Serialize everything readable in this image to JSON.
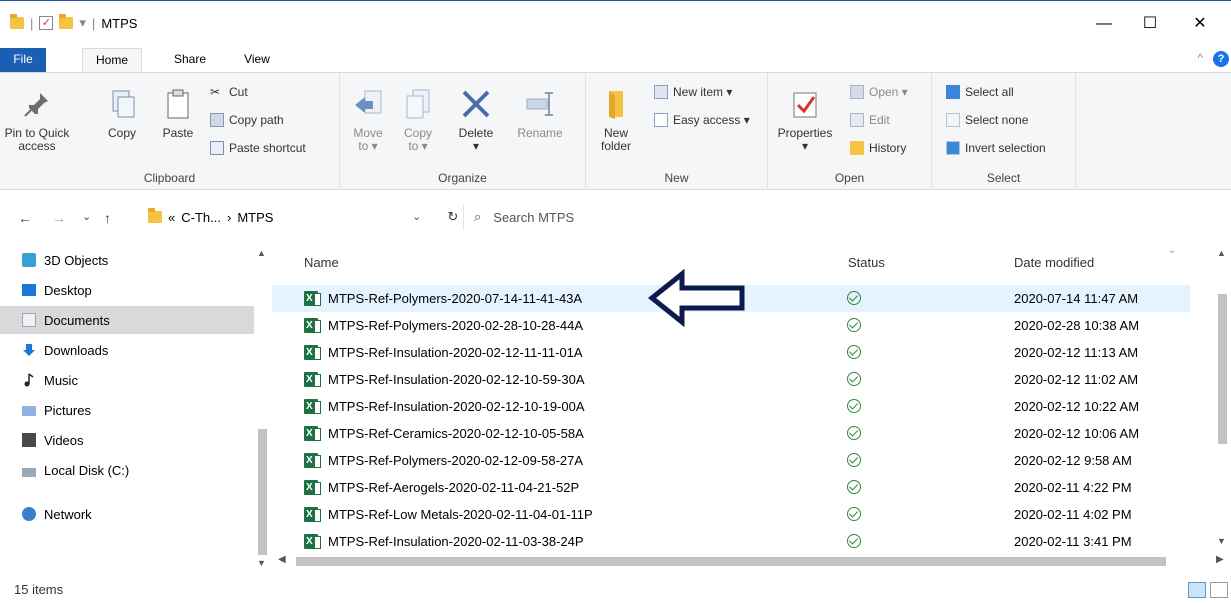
{
  "window": {
    "title": "MTPS",
    "qat_separator": "|",
    "qat_dropdown": "▾",
    "minimize": "—",
    "maximize": "☐",
    "close": "✕"
  },
  "ribbon_tabs": {
    "file": "File",
    "home": "Home",
    "share": "Share",
    "view": "View",
    "collapse": "^",
    "help": "?"
  },
  "clipboard": {
    "pin": "Pin to Quick access",
    "copy": "Copy",
    "paste": "Paste",
    "cut": "Cut",
    "copy_path": "Copy path",
    "paste_shortcut": "Paste shortcut",
    "label": "Clipboard"
  },
  "organize": {
    "move_to": "Move to ▾",
    "copy_to": "Copy to ▾",
    "delete": "Delete",
    "delete_dd": "▾",
    "rename": "Rename",
    "label": "Organize"
  },
  "new_group": {
    "new_folder": "New folder",
    "new_item": "New item ▾",
    "easy_access": "Easy access ▾",
    "label": "New"
  },
  "open_group": {
    "properties": "Properties",
    "properties_dd": "▾",
    "open": "Open ▾",
    "edit": "Edit",
    "history": "History",
    "label": "Open"
  },
  "select_group": {
    "select_all": "Select all",
    "select_none": "Select none",
    "invert_selection": "Invert selection",
    "label": "Select"
  },
  "address": {
    "back": "←",
    "forward": "→",
    "recent": "⌄",
    "up": "↑",
    "path_prefix": "«",
    "crumb1": "C-Th...",
    "sep": "›",
    "crumb2": "MTPS",
    "dropdown": "⌄",
    "refresh": "↻",
    "search_icon": "⌕",
    "search_placeholder": "Search MTPS"
  },
  "nav_pane": {
    "items": [
      {
        "label": "3D Objects",
        "icon": "3d-objects-icon"
      },
      {
        "label": "Desktop",
        "icon": "desktop-icon"
      },
      {
        "label": "Documents",
        "icon": "documents-icon"
      },
      {
        "label": "Downloads",
        "icon": "downloads-icon"
      },
      {
        "label": "Music",
        "icon": "music-icon"
      },
      {
        "label": "Pictures",
        "icon": "pictures-icon"
      },
      {
        "label": "Videos",
        "icon": "videos-icon"
      },
      {
        "label": "Local Disk (C:)",
        "icon": "local-disk-icon"
      },
      {
        "label": "Network",
        "icon": "network-icon"
      }
    ],
    "selected": "Documents"
  },
  "file_list": {
    "columns": {
      "name": "Name",
      "status": "Status",
      "date": "Date modified"
    },
    "sort_indicator": "⌄",
    "rows": [
      {
        "name": "MTPS-Ref-Polymers-2020-07-14-11-41-43A",
        "date": "2020-07-14 11:47 AM"
      },
      {
        "name": "MTPS-Ref-Polymers-2020-02-28-10-28-44A",
        "date": "2020-02-28 10:38 AM"
      },
      {
        "name": "MTPS-Ref-Insulation-2020-02-12-11-11-01A",
        "date": "2020-02-12 11:13 AM"
      },
      {
        "name": "MTPS-Ref-Insulation-2020-02-12-10-59-30A",
        "date": "2020-02-12 11:02 AM"
      },
      {
        "name": "MTPS-Ref-Insulation-2020-02-12-10-19-00A",
        "date": "2020-02-12 10:22 AM"
      },
      {
        "name": "MTPS-Ref-Ceramics-2020-02-12-10-05-58A",
        "date": "2020-02-12 10:06 AM"
      },
      {
        "name": "MTPS-Ref-Polymers-2020-02-12-09-58-27A",
        "date": "2020-02-12 9:58 AM"
      },
      {
        "name": "MTPS-Ref-Aerogels-2020-02-11-04-21-52P",
        "date": "2020-02-11 4:22 PM"
      },
      {
        "name": "MTPS-Ref-Low Metals-2020-02-11-04-01-11P",
        "date": "2020-02-11 4:02 PM"
      },
      {
        "name": "MTPS-Ref-Insulation-2020-02-11-03-38-24P",
        "date": "2020-02-11 3:41 PM"
      }
    ],
    "selected_index": 0
  },
  "status_bar": {
    "item_count": "15 items"
  },
  "colors": {
    "accent": "#1a5fb4",
    "selection": "#e5f3ff",
    "nav_selection": "#d9d9d9",
    "status_ok": "#2e8b3a",
    "annotation_arrow": "#0d1b4c"
  }
}
